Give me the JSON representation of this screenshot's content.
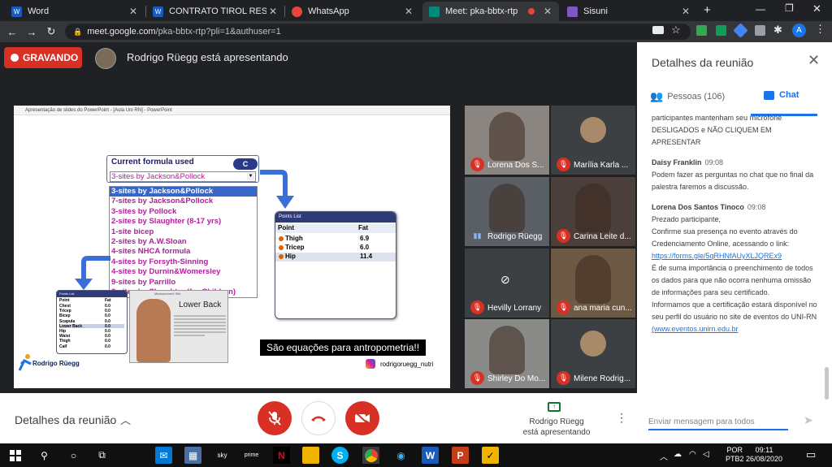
{
  "browser": {
    "tabs": [
      {
        "title": "Word",
        "icon": "word-icon",
        "color": "#185abd"
      },
      {
        "title": "CONTRATO TIROL RESIDENCE",
        "icon": "word-icon",
        "color": "#185abd"
      },
      {
        "title": "WhatsApp",
        "icon": "whatsapp-icon",
        "color": "#e8453c"
      },
      {
        "title": "Meet: pka-bbtx-rtp",
        "icon": "meet-icon",
        "color": "#00897b",
        "active": true
      },
      {
        "title": "Sisuni",
        "icon": "sisuni-icon",
        "color": "#7e57c2"
      }
    ],
    "new_tab": "+",
    "url_host": "meet.google.com",
    "url_path": "/pka-bbtx-rtp?pli=1&authuser=1",
    "profile_initial": "A"
  },
  "meet": {
    "recording_label": "GRAVANDO",
    "presenter_banner": "Rodrigo Rüegg está apresentando",
    "ppt_window_title": "Apresentação de slides do PowerPoint - [Aula Uni RN] - PowerPoint",
    "slide": {
      "formula_title": "Current formula used",
      "formula_badge": "C",
      "formula_selected": "3-sites by Jackson&Pollock",
      "formula_options": [
        "3-sites by Jackson&Pollock",
        "7-sites by Jackson&Pollock",
        "3-sites by Pollock",
        "2-sites by Slaughter (8-17 yrs)",
        "1-site bicep",
        "2-sites by A.W.Sloan",
        "4-sites NHCA formula",
        "4-sites by Forsyth-Sinning",
        "4-sites by Durnin&Womersley",
        "9-sites by  Parrillo",
        "2-sites by Slaughter (for Children)"
      ],
      "points_list_title": "Points List",
      "points_cols": [
        "Point",
        "Fat"
      ],
      "points": [
        {
          "point": "Thigh",
          "fat": "6.9"
        },
        {
          "point": "Tricep",
          "fat": "6.0"
        },
        {
          "point": "Hip",
          "fat": "11.4"
        }
      ],
      "small_list_title": "Points List",
      "small_cols": [
        "Point",
        "Fat"
      ],
      "small_rows": [
        [
          "Chest",
          "0.0"
        ],
        [
          "Tricep",
          "0.0"
        ],
        [
          "Bicep",
          "0.0"
        ],
        [
          "Scapula",
          "0.0"
        ],
        [
          "Lower Back",
          "0.0"
        ],
        [
          "Hip",
          "0.0"
        ],
        [
          "Waist",
          "0.0"
        ],
        [
          "Thigh",
          "0.0"
        ],
        [
          "Calf",
          "0.0"
        ]
      ],
      "measurement_title": "Measurement Site",
      "measurement_label": "Lower Back",
      "caption": "São equações para antropometria!!",
      "logo_text": "Rodrigo Rüegg",
      "instagram": "rodrigoruegg_nutri"
    },
    "participants": [
      {
        "name": "Lorena Dos S...",
        "muted": true,
        "bg": "#8a8580"
      },
      {
        "name": "Marília Karla ...",
        "muted": true,
        "bg": "#3c4043",
        "avatar": true
      },
      {
        "name": "Rodrigo Rüegg",
        "muted": false,
        "bg": "#5a5f66"
      },
      {
        "name": "Carina Leite d...",
        "muted": true,
        "bg": "#4a3f3a"
      },
      {
        "name": "Hevilly Lorrany",
        "muted": true,
        "bg": "#3c4043",
        "camoff": true
      },
      {
        "name": "ana maria cun...",
        "muted": true,
        "bg": "#6d5a45"
      },
      {
        "name": "Shirley Do Mo...",
        "muted": true,
        "bg": "#8a8a88"
      },
      {
        "name": "Milene Rodrig...",
        "muted": true,
        "bg": "#3c4043",
        "avatar": true
      }
    ],
    "bottom": {
      "details_label": "Detalhes da reunião",
      "presenting_line1": "Rodrigo Rüegg",
      "presenting_line2": "está apresentando"
    }
  },
  "panel": {
    "title": "Detalhes da reunião",
    "tab_people": "Pessoas (106)",
    "tab_chat": "Chat",
    "messages": [
      {
        "sender": "",
        "time": "",
        "text": "participantes mantenham seu microfone DESLIGADOS e NÃO CLIQUEM EM APRESENTAR"
      },
      {
        "sender": "Daisy Franklin",
        "time": "09:08",
        "text": "Podem fazer as perguntas no chat que no final da palestra faremos a discussão."
      },
      {
        "sender": "Lorena Dos Santos Tinoco",
        "time": "09:08",
        "text": "Prezado participante,\nConfirme sua presença no evento através do Credenciamento Online, acessando o link:",
        "link": "https://forms.gle/5qRHNfAUyXLJQREx9",
        "text2": "É de suma importância o preenchimento de todos os dados para que não ocorra nenhuma omissão de informações para seu certificado.\nInformamos que a certificação estará disponível no seu perfil do usuário no site de eventos do UNI-RN",
        "link2": "(www.eventos.unirn.edu.br"
      }
    ],
    "input_placeholder": "Enviar mensagem para todos"
  },
  "taskbar": {
    "lang1": "POR",
    "lang2": "PTB2",
    "time": "09:11",
    "date": "26/08/2020"
  }
}
